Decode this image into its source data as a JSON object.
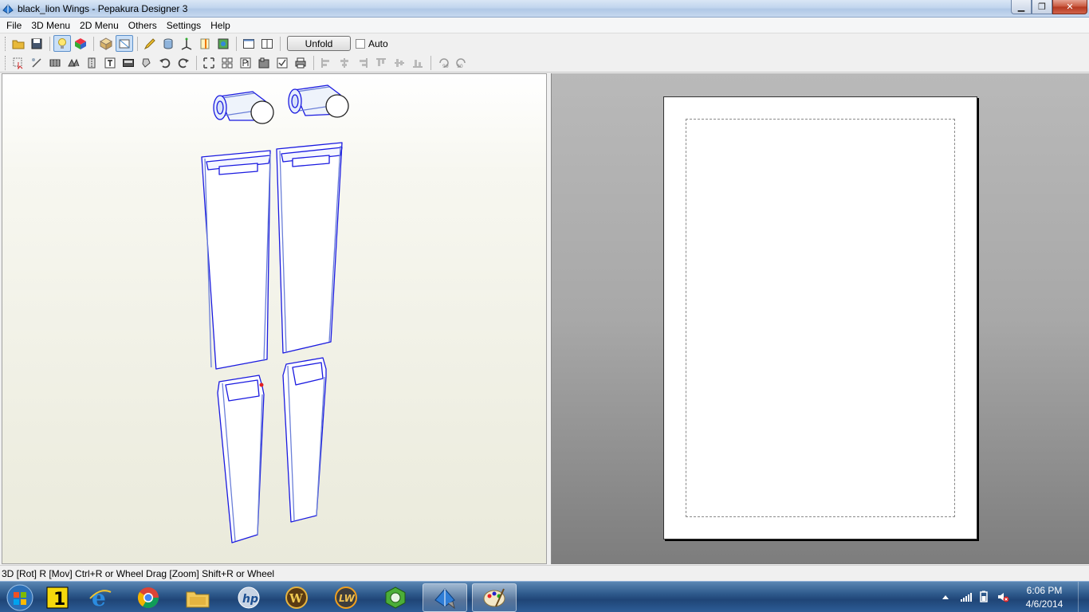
{
  "window": {
    "title": "black_lion Wings - Pepakura Designer 3",
    "min_glyph": "▁",
    "max_glyph": "❐",
    "close_glyph": "✕"
  },
  "menu": [
    "File",
    "3D Menu",
    "2D Menu",
    "Others",
    "Settings",
    "Help"
  ],
  "toolbar1": {
    "icons": [
      "open-folder-icon",
      "save-icon",
      "light-bulb-icon",
      "texture-cube-icon",
      "box-icon",
      "unfold-view-icon",
      "pencil-icon",
      "cylinder-icon",
      "axis-icon",
      "edge-icon",
      "color-icon",
      "single-pane-icon",
      "split-pane-icon"
    ],
    "unfold_label": "Unfold",
    "auto_label": "Auto",
    "auto_checked": false
  },
  "toolbar2": {
    "icons": [
      "select-arrow-icon",
      "edit-line-icon",
      "join-icon",
      "flap-icon",
      "fold-icon",
      "text-icon",
      "image-icon",
      "move-part-icon",
      "undo-icon",
      "redo-icon",
      "fit-icon",
      "arrange-icon",
      "page-number-icon",
      "layout-icon",
      "check-icon",
      "print-icon",
      "align-left-icon",
      "align-center-icon",
      "align-right-icon",
      "align-top-icon",
      "align-middle-icon",
      "align-bottom-icon",
      "rotate-90-ccw-icon",
      "rotate-90-cw-icon"
    ]
  },
  "status": {
    "text": "3D [Rot] R [Mov] Ctrl+R or Wheel Drag [Zoom] Shift+R or Wheel"
  },
  "taskbar": {
    "apps": [
      "norton-icon",
      "internet-explorer-icon",
      "chrome-icon",
      "file-explorer-icon",
      "hp-icon",
      "warcraft-icon",
      "lightwave-icon",
      "settings-hex-icon",
      "pepakura-icon",
      "paint-icon"
    ],
    "time": "6:06 PM",
    "date": "4/6/2014"
  },
  "colors": {
    "model_edge": "#1a1ae0",
    "model_fill": "#ffffff",
    "accent": "#5b8fc9"
  }
}
